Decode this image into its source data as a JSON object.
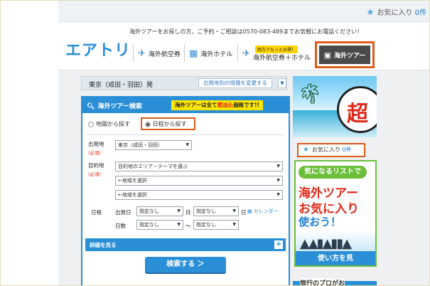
{
  "topbar": {
    "favorites_label": "お気に入り",
    "favorites_count": "0件"
  },
  "header": {
    "notice": "海外ツアーをお探しの方、ご予約・ご相談は0570-083-489までお気軽にお電話ください！",
    "logo": "エアトリ",
    "nav": {
      "flights": "海外航空券",
      "hotels": "海外ホテル",
      "flight_hotel_promo": "両方でもっとお得！",
      "flight_hotel": "海外航空券＋ホテル",
      "tours": "海外ツアー"
    }
  },
  "departure": {
    "label": "東京（成田・羽田）発",
    "change_button": "出発地別の情報を変更する",
    "dropdown": "▼"
  },
  "search": {
    "title": "海外ツアー検索",
    "banner_pre": "海外ツアーは全て",
    "banner_red": "燃油込",
    "banner_post": "価格です!!",
    "radio_map": "地図から探す",
    "radio_date": "日程から探す",
    "origin_label": "出発地",
    "required": "(必須)",
    "origin_value": "東京（成田・羽田）",
    "dest_label": "目的地",
    "dest_area": "目的地のエリア・テーマを選ぶ",
    "dest_region1": "←地域を選択",
    "dest_region2": "←地域を選択",
    "schedule_label": "日程",
    "depart_label": "出発日",
    "month_value": "指定なし",
    "month_unit": "月",
    "day_value": "指定なし",
    "day_unit": "日",
    "calendar": "カレンダー",
    "days_label": "日数",
    "days_from": "指定なし",
    "tilde": "〜",
    "days_to": "指定なし",
    "details": "詳細を見る",
    "submit": "検索する ＞"
  },
  "sidebar": {
    "ad_kanji": "超",
    "favorites_label": "お気に入り",
    "favorites_count": "0件",
    "ad_pill": "気になるリストで",
    "ad_line1": "海外ツアー",
    "ad_line2": "お気に入り",
    "ad_line3": "使おう！",
    "ad_howto": "使い方を見",
    "bottom_text": "旅行のプロがお"
  }
}
